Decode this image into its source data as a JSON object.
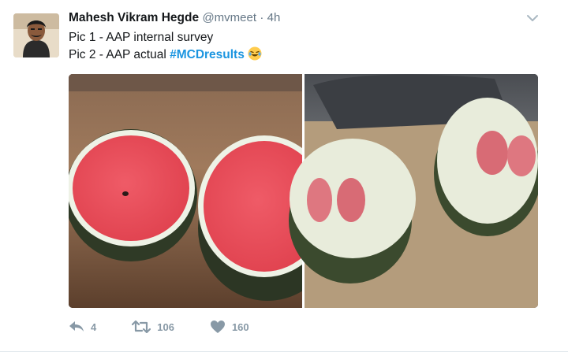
{
  "author": {
    "name": "Mahesh Vikram Hegde",
    "handle": "@mvmeet",
    "separator": "·",
    "time": "4h"
  },
  "tweet": {
    "line1": "Pic 1 - AAP internal survey",
    "line2_prefix": "Pic 2 - AAP actual ",
    "hashtag": "#MCDresults",
    "emoji_icon": "face-with-tears-of-joy-icon"
  },
  "actions": {
    "reply_count": "4",
    "retweet_count": "106",
    "like_count": "160"
  },
  "colors": {
    "hashtag": "#1b95e0",
    "action_gray": "#8899a6",
    "name": "#14171a",
    "meta": "#657786"
  }
}
